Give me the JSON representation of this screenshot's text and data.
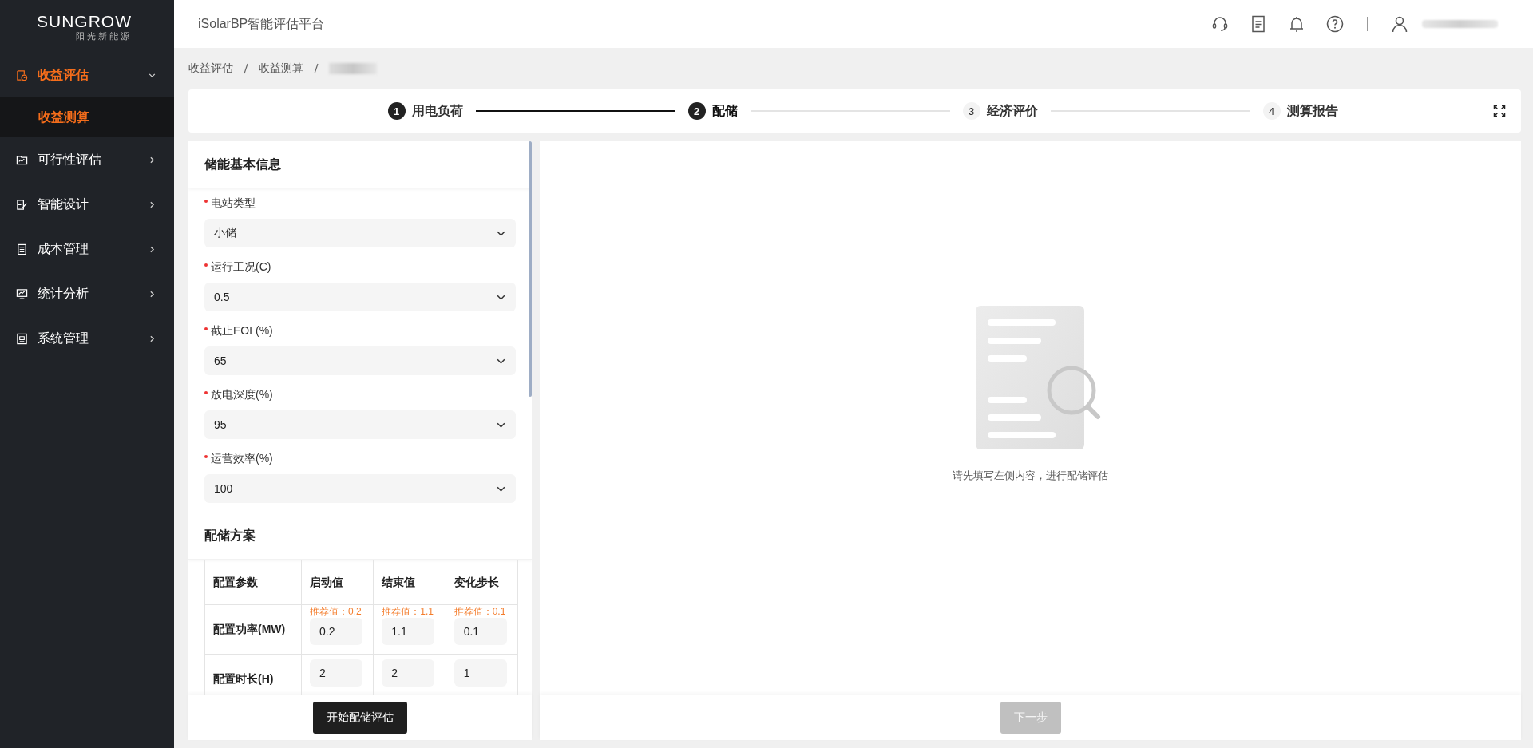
{
  "logo": {
    "name": "SUNGROW",
    "subtitle": "阳光新能源"
  },
  "sidebar": {
    "items": [
      {
        "label": "收益评估",
        "expanded": true,
        "selected": true,
        "children": [
          {
            "label": "收益测算",
            "selected": true
          }
        ]
      },
      {
        "label": "可行性评估",
        "expanded": false,
        "selected": false
      },
      {
        "label": "智能设计",
        "expanded": false,
        "selected": false
      },
      {
        "label": "成本管理",
        "expanded": false,
        "selected": false
      },
      {
        "label": "统计分析",
        "expanded": false,
        "selected": false
      },
      {
        "label": "系统管理",
        "expanded": false,
        "selected": false
      }
    ]
  },
  "header": {
    "title": "iSolarBP智能评估平台"
  },
  "breadcrumb": [
    "收益评估",
    "收益测算"
  ],
  "steps": [
    {
      "number": "1",
      "label": "用电负荷",
      "completed": true,
      "selected": false
    },
    {
      "number": "2",
      "label": "配储",
      "completed": false,
      "selected": true
    },
    {
      "number": "3",
      "label": "经济评价",
      "completed": false,
      "selected": false
    },
    {
      "number": "4",
      "label": "测算报告",
      "completed": false,
      "selected": false
    }
  ],
  "form": {
    "title": "储能基本信息",
    "fields": [
      {
        "label": "电站类型",
        "required": true,
        "value": "小储"
      },
      {
        "label": "运行工况(C)",
        "required": true,
        "value": "0.5"
      },
      {
        "label": "截止EOL(%)",
        "required": true,
        "value": "65"
      },
      {
        "label": "放电深度(%)",
        "required": true,
        "value": "95"
      },
      {
        "label": "运营效率(%)",
        "required": true,
        "value": "100"
      }
    ],
    "plan_title": "配储方案",
    "table": {
      "columns": [
        "配置参数",
        "启动值",
        "结束值",
        "变化步长"
      ],
      "rows": [
        {
          "cells": [
            {
              "value": "配置功率(MW)"
            },
            {
              "hint": "推荐值：0.2",
              "value": "0.2"
            },
            {
              "hint": "推荐值：1.1",
              "value": "1.1"
            },
            {
              "hint": "推荐值：0.1",
              "value": "0.1"
            }
          ]
        },
        {
          "cells": [
            {
              "value": "配置时长(H)"
            },
            {
              "value": "2"
            },
            {
              "value": "2"
            },
            {
              "value": "1"
            }
          ]
        }
      ]
    },
    "submit": "开始配储评估"
  },
  "empty_state": {
    "message": "请先填写左侧内容，进行配储评估"
  },
  "next_button": {
    "label": "下一步",
    "disabled": true
  }
}
